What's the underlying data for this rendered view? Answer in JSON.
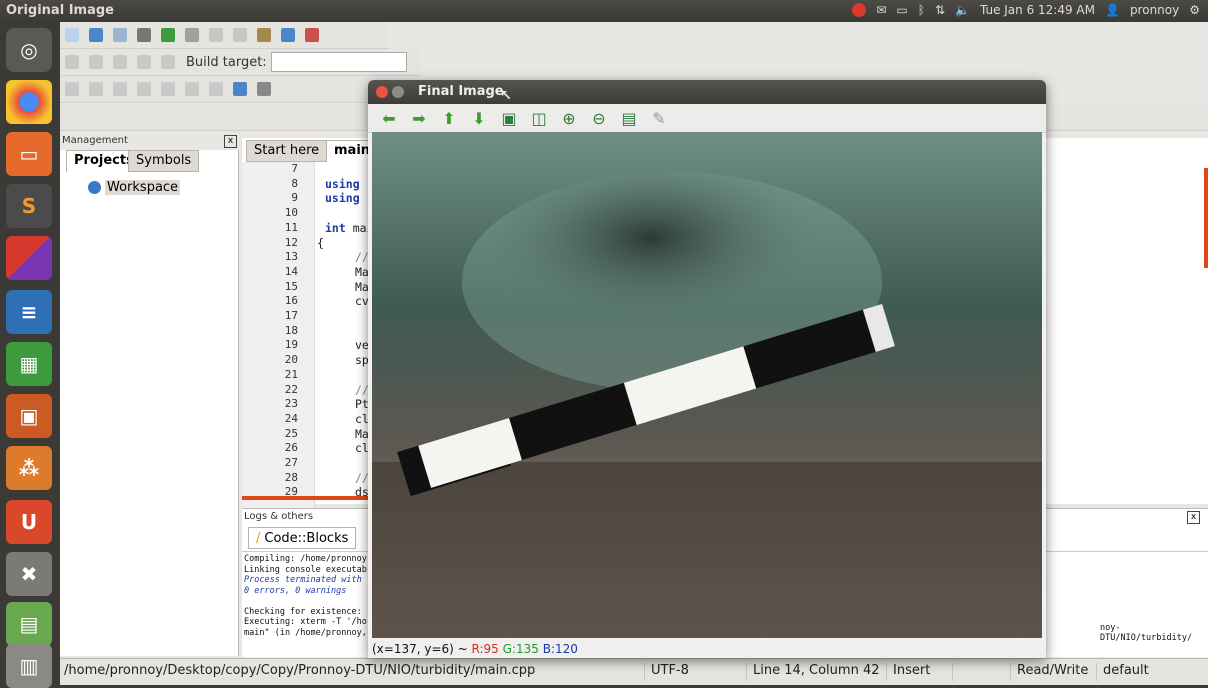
{
  "top_panel": {
    "title": "Original Image",
    "clock": "Tue Jan 6 12:49 AM",
    "user": "pronnoy"
  },
  "codeblocks": {
    "build_target_label": "Build target:",
    "management": {
      "title": "Management",
      "tabs": [
        "Projects",
        "Symbols"
      ],
      "tree_item": "Workspace"
    },
    "editor_tabs": [
      "Start here",
      "main."
    ],
    "line_numbers": [
      "7",
      "8",
      "9",
      "10",
      "11",
      "12",
      "13",
      "14",
      "15",
      "16",
      "17",
      "18",
      "19",
      "20",
      "21",
      "22",
      "23",
      "24",
      "25",
      "26",
      "27",
      "28",
      "29"
    ],
    "code_lines": [
      {
        "n": "8",
        "text": "using r"
      },
      {
        "n": "9",
        "text": "using r"
      },
      {
        "n": "11",
        "text": "int mai"
      },
      {
        "n": "12",
        "text": "{"
      },
      {
        "n": "13",
        "text": "// c"
      },
      {
        "n": "14",
        "text": "Ma"
      },
      {
        "n": "15",
        "text": "Ma"
      },
      {
        "n": "16",
        "text": "cvt"
      },
      {
        "n": "19",
        "text": "vec"
      },
      {
        "n": "20",
        "text": "spl"
      },
      {
        "n": "22",
        "text": "// a"
      },
      {
        "n": "23",
        "text": "Ptr"
      },
      {
        "n": "24",
        "text": "cla"
      },
      {
        "n": "25",
        "text": "Ma"
      },
      {
        "n": "26",
        "text": "cla"
      },
      {
        "n": "28",
        "text": "// r"
      },
      {
        "n": "29",
        "text": "dst"
      }
    ],
    "logs": {
      "title": "Logs & others",
      "tab": "Code::Blocks",
      "lines": [
        "Compiling: /home/pronnoy",
        "Linking console executab",
        "Process terminated with",
        "0 errors, 0 warnings",
        "",
        "Checking for existence:",
        "Executing: xterm -T '/ho",
        "main\" (in /home/pronnoy,"
      ],
      "right_text": "noy-DTU/NIO/turbidity/"
    },
    "status_bar": {
      "path": "/home/pronnoy/Desktop/copy/Copy/Pronnoy-DTU/NIO/turbidity/main.cpp",
      "encoding": "UTF-8",
      "position": "Line 14, Column 42",
      "mode": "Insert",
      "access": "Read/Write",
      "profile": "default"
    }
  },
  "final_image_window": {
    "title": "Final Image",
    "pixel_info_prefix": "(x=137, y=6) ~ ",
    "r": "R:95",
    "g": "G:135",
    "b": "B:120",
    "tools": [
      "arrow-left-icon",
      "arrow-right-icon",
      "arrow-up-icon",
      "arrow-down-icon",
      "fit-icon",
      "zoom-region-icon",
      "zoom-in-icon",
      "zoom-out-icon",
      "save-icon",
      "brush-icon"
    ]
  },
  "colors": {
    "ubuntu_orange": "#dd4814",
    "accent_blue": "#1c3aa8"
  }
}
